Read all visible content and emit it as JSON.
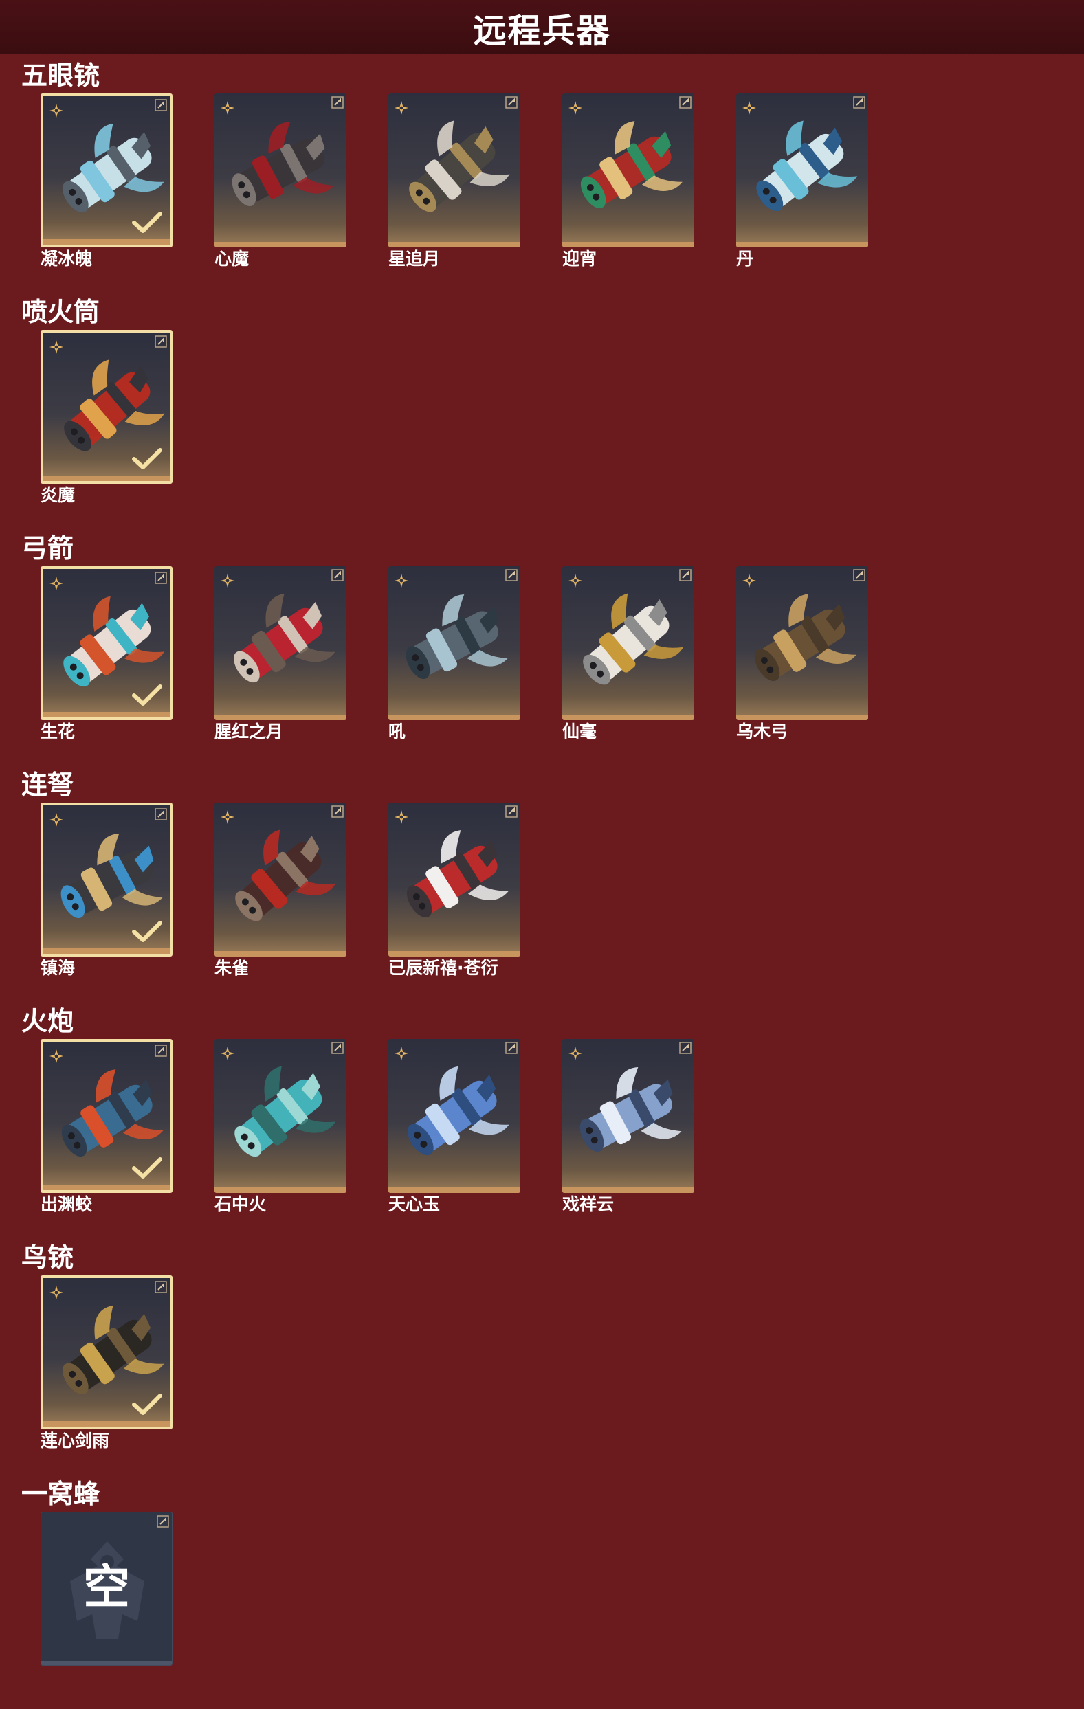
{
  "header": {
    "title": "远程兵器"
  },
  "colors": {
    "background": "#6b1a1e",
    "header_background": "#3a0d10",
    "selected_border": "#f3dfa6",
    "card_bottom_bar": "#c8955e",
    "star_badge": "#e7b663",
    "empty_card": "#2f3646"
  },
  "icons": {
    "star": "four-point-star-icon",
    "corner": "corner-fold-icon",
    "selected": "checkmark-icon",
    "empty": "empty-slot-emblem-icon"
  },
  "sections": [
    {
      "title": "五眼铳",
      "items": [
        {
          "name": "凝冰魄",
          "selected": true,
          "palette": [
            "#cfe9f1",
            "#7fc6de",
            "#55606b"
          ]
        },
        {
          "name": "心魔",
          "selected": false,
          "palette": [
            "#3a3538",
            "#9c1e25",
            "#7b7470"
          ]
        },
        {
          "name": "星追月",
          "selected": false,
          "palette": [
            "#4a4640",
            "#d8d2c8",
            "#a58a55"
          ]
        },
        {
          "name": "迎宵",
          "selected": false,
          "palette": [
            "#b12a25",
            "#e3c07c",
            "#2f8d62"
          ]
        },
        {
          "name": "丹",
          "selected": false,
          "palette": [
            "#d9eef4",
            "#69bfd8",
            "#2d5d8a"
          ]
        }
      ]
    },
    {
      "title": "喷火筒",
      "items": [
        {
          "name": "炎魔",
          "selected": true,
          "palette": [
            "#b82b20",
            "#e0a24a",
            "#34333a"
          ]
        }
      ]
    },
    {
      "title": "弓箭",
      "items": [
        {
          "name": "生花",
          "selected": true,
          "palette": [
            "#f1e5dc",
            "#d4542c",
            "#3fb4c4"
          ]
        },
        {
          "name": "腥红之月",
          "selected": false,
          "palette": [
            "#c0232f",
            "#6a5a50",
            "#d1c2b6"
          ]
        },
        {
          "name": "吼",
          "selected": false,
          "palette": [
            "#5a6874",
            "#a8c4d0",
            "#2d3a44"
          ]
        },
        {
          "name": "仙毫",
          "selected": false,
          "palette": [
            "#f2eee6",
            "#c99a3a",
            "#8c8c8c"
          ]
        },
        {
          "name": "乌木弓",
          "selected": false,
          "palette": [
            "#6b5236",
            "#c8a060",
            "#4a3a2a"
          ]
        }
      ]
    },
    {
      "title": "连弩",
      "items": [
        {
          "name": "镇海",
          "selected": true,
          "palette": [
            "#3a3a3e",
            "#d6b574",
            "#3c8fc7"
          ]
        },
        {
          "name": "朱雀",
          "selected": false,
          "palette": [
            "#4a2a28",
            "#b72a22",
            "#8c7464"
          ]
        },
        {
          "name": "已辰新禧·苍衍",
          "selected": false,
          "palette": [
            "#c22a2a",
            "#f2f0ee",
            "#3a3438"
          ]
        }
      ]
    },
    {
      "title": "火炮",
      "items": [
        {
          "name": "出渊蛟",
          "selected": true,
          "palette": [
            "#3a6f96",
            "#d9502a",
            "#2e3c4e"
          ]
        },
        {
          "name": "石中火",
          "selected": false,
          "palette": [
            "#43b8c0",
            "#2f6e6a",
            "#9ed8d4"
          ]
        },
        {
          "name": "天心玉",
          "selected": false,
          "palette": [
            "#5d8ad6",
            "#c7daf4",
            "#2e4e80"
          ]
        },
        {
          "name": "戏祥云",
          "selected": false,
          "palette": [
            "#8aa8d4",
            "#e8eef8",
            "#3a4a6a"
          ]
        }
      ]
    },
    {
      "title": "鸟铳",
      "items": [
        {
          "name": "莲心剑雨",
          "selected": true,
          "palette": [
            "#2a2622",
            "#c9a24e",
            "#6e5a3a"
          ]
        }
      ]
    },
    {
      "title": "一窝蜂",
      "items": [
        {
          "name": "",
          "empty": true,
          "empty_label": "空",
          "selected": false
        }
      ]
    }
  ]
}
